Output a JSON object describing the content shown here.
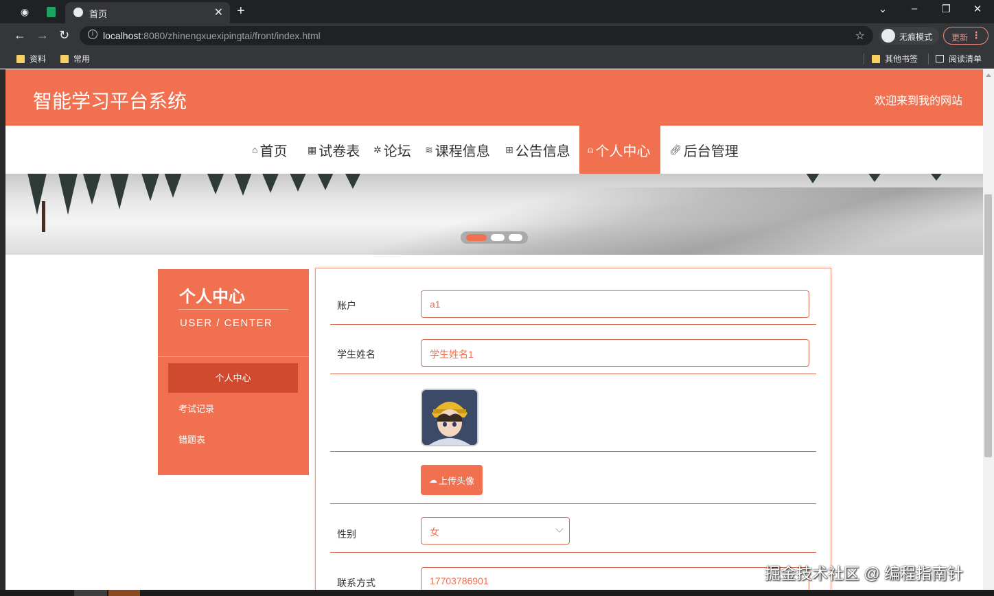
{
  "browser": {
    "tab_title": "首页",
    "url_host": "localhost",
    "url_rest": ":8080/zhinengxuexipingtai/front/index.html",
    "incognito_label": "无痕模式",
    "update_label": "更新",
    "bookmarks": [
      "资料",
      "常用"
    ],
    "other_bookmarks": "其他书签",
    "reading_list": "阅读清单"
  },
  "header": {
    "title": "智能学习平台系统",
    "welcome": "欢迎来到我的网站"
  },
  "nav": {
    "items": [
      {
        "label": "首页",
        "icon": "home-icon"
      },
      {
        "label": "试卷表",
        "icon": "grid-icon"
      },
      {
        "label": "论坛",
        "icon": "forum-icon"
      },
      {
        "label": "课程信息",
        "icon": "layers-icon"
      },
      {
        "label": "公告信息",
        "icon": "gift-icon"
      },
      {
        "label": "个人中心",
        "icon": "user-icon",
        "active": true
      },
      {
        "label": "后台管理",
        "icon": "link-icon"
      }
    ]
  },
  "sidebar": {
    "title": "个人中心",
    "subtitle": "USER / CENTER",
    "items": [
      {
        "label": "个人中心",
        "active": true
      },
      {
        "label": "考试记录"
      },
      {
        "label": "错题表"
      }
    ]
  },
  "form": {
    "account_label": "账户",
    "account_value": "a1",
    "name_label": "学生姓名",
    "name_value": "学生姓名1",
    "upload_label": "上传头像",
    "gender_label": "性别",
    "gender_value": "女",
    "phone_label": "联系方式",
    "phone_value": "17703786901"
  },
  "watermark": "掘金技术社区 @ 编程指南针",
  "colors": {
    "accent": "#f07050",
    "accent_dark": "#d04a30"
  }
}
